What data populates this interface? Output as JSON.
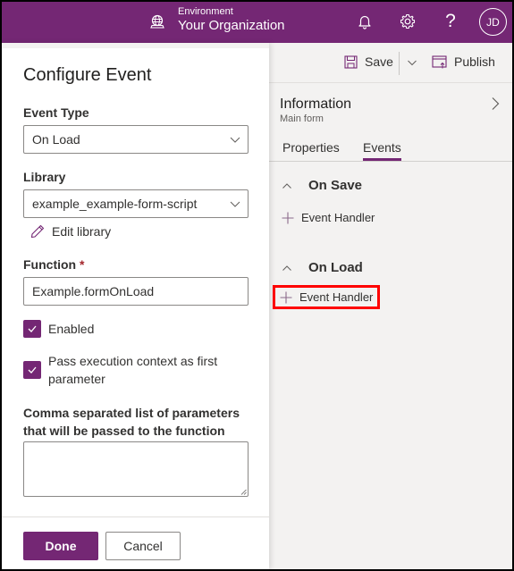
{
  "topbar": {
    "environment_label": "Environment",
    "environment_name": "Your Organization",
    "icons": [
      "environment-globe-icon",
      "bell-icon",
      "gear-icon",
      "help-icon"
    ],
    "help_glyph": "?",
    "avatar_initials": "JD",
    "brand_color": "#742774"
  },
  "configure_panel": {
    "title": "Configure Event",
    "event_type": {
      "label": "Event Type",
      "value": "On Load"
    },
    "library": {
      "label": "Library",
      "value": "example_example-form-script",
      "edit_link": "Edit library"
    },
    "function": {
      "label": "Function",
      "required_marker": "*",
      "value": "Example.formOnLoad"
    },
    "checkboxes": [
      {
        "label": "Enabled",
        "checked": true
      },
      {
        "label": "Pass execution context as first parameter",
        "checked": true
      }
    ],
    "parameters": {
      "label": "Comma separated list of parameters that will be passed to the function",
      "value": ""
    },
    "buttons": {
      "done": "Done",
      "cancel": "Cancel"
    }
  },
  "command_bar": {
    "save": "Save",
    "publish": "Publish"
  },
  "info_panel": {
    "title": "Information",
    "subtitle": "Main form",
    "tabs": [
      {
        "label": "Properties",
        "active": false
      },
      {
        "label": "Events",
        "active": true
      }
    ],
    "sections": [
      {
        "title": "On Save",
        "handler_label": "Event Handler",
        "highlighted": false
      },
      {
        "title": "On Load",
        "handler_label": "Event Handler",
        "highlighted": true
      }
    ],
    "highlight_color": "#ff0000"
  }
}
